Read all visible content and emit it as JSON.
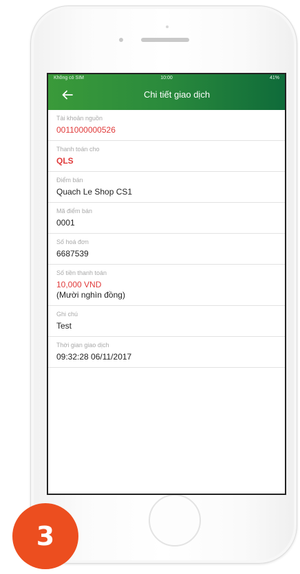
{
  "status_bar": {
    "carrier": "Không có SIM",
    "time": "10:00",
    "battery": "41%"
  },
  "header": {
    "title": "Chi tiết giao dịch",
    "back_icon": "arrow-left-icon"
  },
  "fields": [
    {
      "label": "Tài khoản nguồn",
      "value": "0011000000526"
    },
    {
      "label": "Thanh toán cho",
      "value": "QLS"
    },
    {
      "label": "Điểm bán",
      "value": "Quach Le Shop CS1"
    },
    {
      "label": "Mã điểm bán",
      "value": "0001"
    },
    {
      "label": "Số hoá đơn",
      "value": "6687539"
    },
    {
      "label": "Số tiền thanh toán",
      "value": "10,000 VND",
      "sub": "(Mười nghìn đồng)"
    },
    {
      "label": "Ghi chú",
      "value": "Test"
    },
    {
      "label": "Thời gian giao dịch",
      "value": "09:32:28 06/11/2017"
    }
  ],
  "step_badge": "3",
  "colors": {
    "header_start": "#3a9a3a",
    "header_end": "#0f6b3a",
    "highlight_red": "#e03a3a",
    "badge_orange": "#ec4e1f"
  }
}
